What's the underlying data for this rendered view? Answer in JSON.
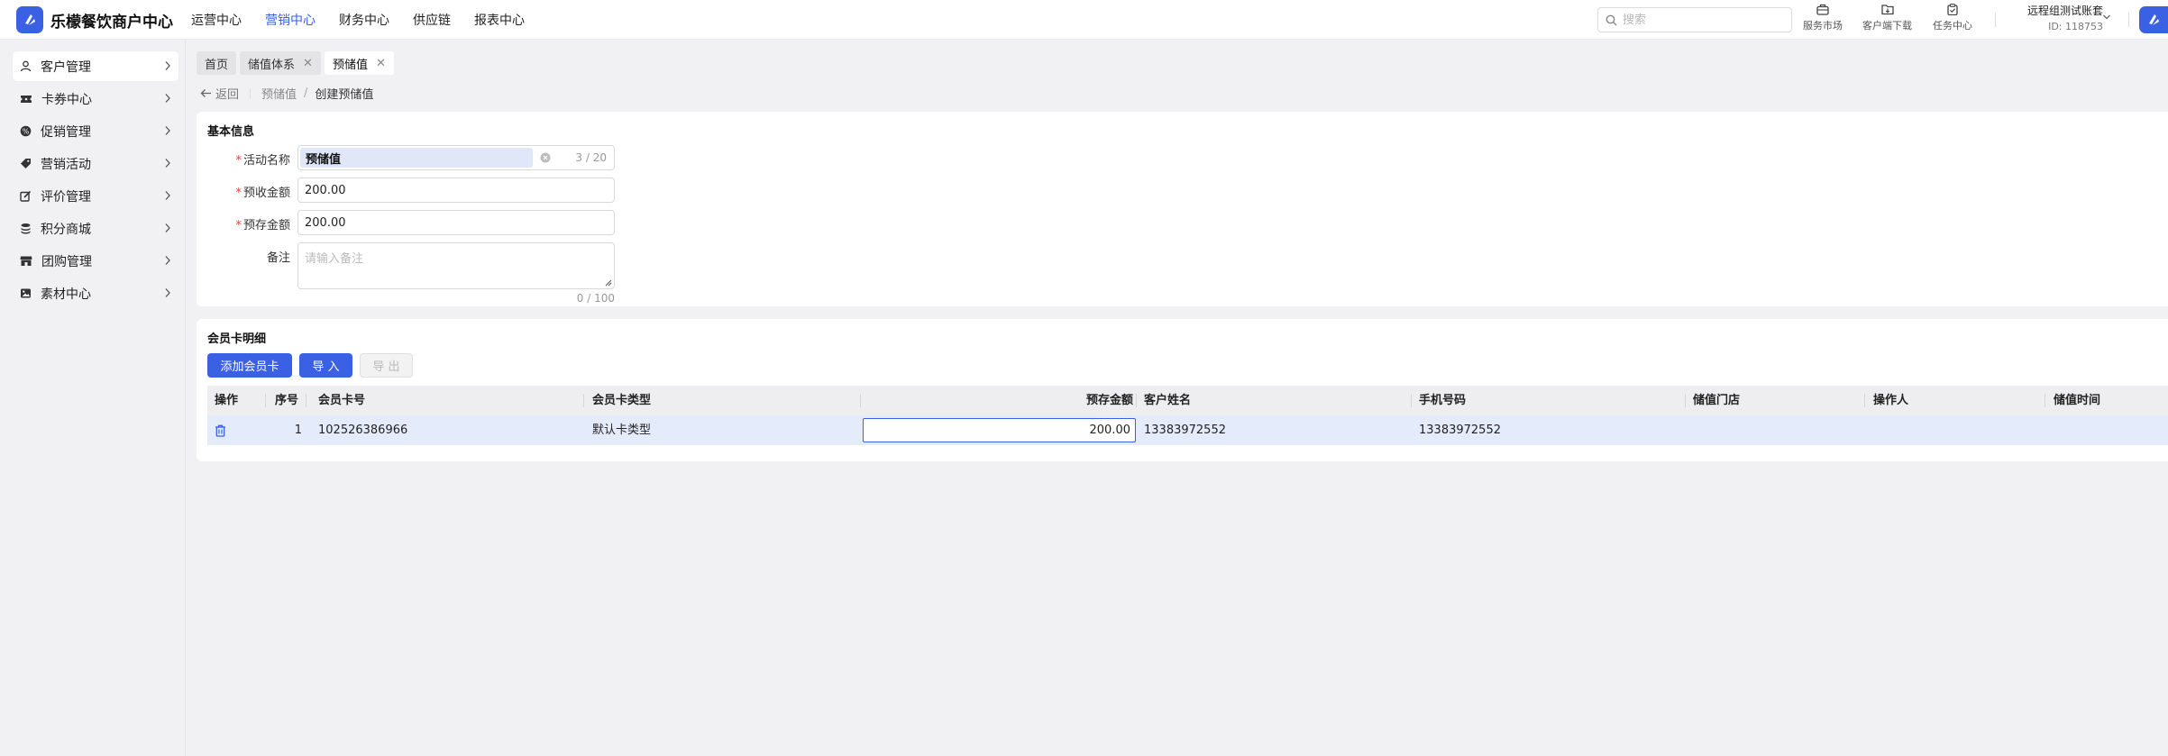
{
  "brand": {
    "name": "乐檬餐饮商户中心",
    "accent": "#3a61e3"
  },
  "topnav": [
    {
      "label": "运营中心",
      "active": false
    },
    {
      "label": "营销中心",
      "active": true
    },
    {
      "label": "财务中心",
      "active": false
    },
    {
      "label": "供应链",
      "active": false
    },
    {
      "label": "报表中心",
      "active": false
    }
  ],
  "search": {
    "placeholder": "搜索",
    "icon": "search-icon"
  },
  "tools": [
    {
      "label": "服务市场",
      "icon": "briefcase-icon"
    },
    {
      "label": "客户端下载",
      "icon": "folder-download-icon"
    },
    {
      "label": "任务中心",
      "icon": "clipboard-icon"
    }
  ],
  "account": {
    "name": "远程组测试账套",
    "id": "ID: 118753"
  },
  "sidebar": [
    {
      "label": "客户管理",
      "icon": "user-icon",
      "active": true
    },
    {
      "label": "卡券中心",
      "icon": "ticket-icon",
      "active": false
    },
    {
      "label": "促销管理",
      "icon": "badge-icon",
      "active": false
    },
    {
      "label": "营销活动",
      "icon": "tag-icon",
      "active": false
    },
    {
      "label": "评价管理",
      "icon": "edit-icon",
      "active": false
    },
    {
      "label": "积分商城",
      "icon": "coins-icon",
      "active": false
    },
    {
      "label": "团购管理",
      "icon": "store-icon",
      "active": false
    },
    {
      "label": "素材中心",
      "icon": "image-icon",
      "active": false
    }
  ],
  "tabs": [
    {
      "label": "首页",
      "closable": false,
      "active": false
    },
    {
      "label": "储值体系",
      "closable": true,
      "active": false
    },
    {
      "label": "预储值",
      "closable": true,
      "active": true
    }
  ],
  "breadcrumb": {
    "back": "返回",
    "parent": "预储值",
    "sep": "/",
    "current": "创建预储值"
  },
  "basic": {
    "title": "基本信息",
    "name_label": "活动名称",
    "name_value": "预储值",
    "name_counter": "3 / 20",
    "receive_label": "预收金额",
    "receive_value": "200.00",
    "deposit_label": "预存金额",
    "deposit_value": "200.00",
    "remark_label": "备注",
    "remark_placeholder": "请输入备注",
    "remark_counter": "0 / 100",
    "required_mark": "*"
  },
  "cards": {
    "title": "会员卡明细",
    "add_button": "添加会员卡",
    "import_button": "导 入",
    "export_button": "导 出",
    "columns": [
      "操作",
      "序号",
      "会员卡号",
      "会员卡类型",
      "预存金额",
      "客户姓名",
      "手机号码",
      "储值门店",
      "操作人",
      "储值时间"
    ],
    "rows": [
      {
        "seq": "1",
        "card_no": "102526386966",
        "card_type": "默认卡类型",
        "amount": "200.00",
        "customer": "13383972552",
        "phone": "13383972552",
        "store": "",
        "operator": "",
        "time": ""
      }
    ]
  }
}
